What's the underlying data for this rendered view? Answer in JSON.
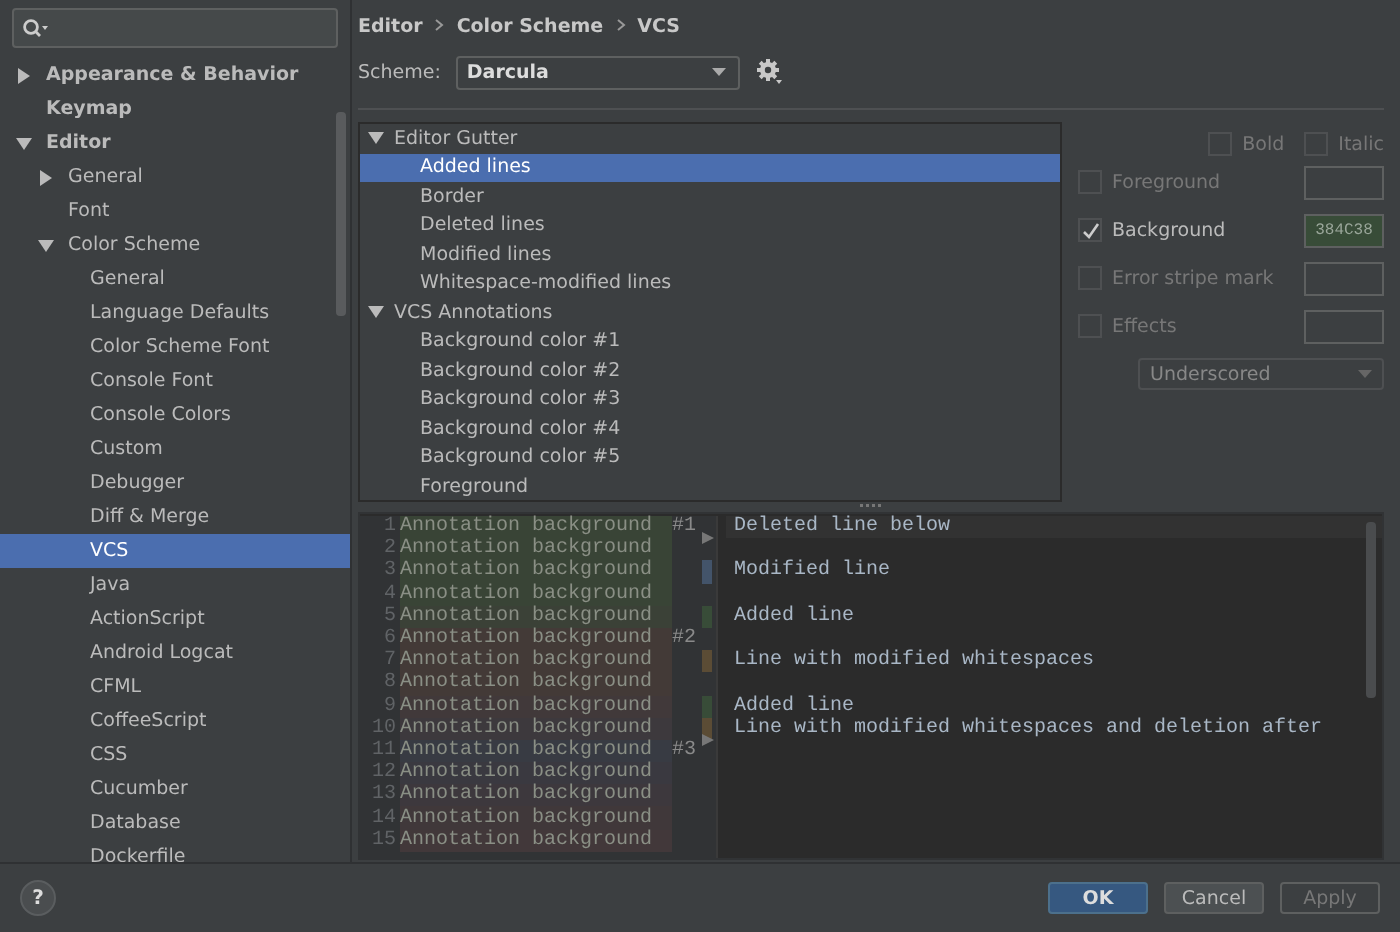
{
  "sidebar": {
    "items": [
      {
        "label": "Appearance & Behavior",
        "expanded": false,
        "selected": false
      },
      {
        "label": "Keymap",
        "selected": false
      },
      {
        "label": "Editor",
        "expanded": true,
        "selected": false,
        "children": [
          {
            "label": "General",
            "expanded": false,
            "selected": false
          },
          {
            "label": "Font",
            "selected": false
          },
          {
            "label": "Color Scheme",
            "expanded": true,
            "selected": false,
            "children": [
              {
                "label": "General",
                "selected": false
              },
              {
                "label": "Language Defaults",
                "selected": false
              },
              {
                "label": "Color Scheme Font",
                "selected": false
              },
              {
                "label": "Console Font",
                "selected": false
              },
              {
                "label": "Console Colors",
                "selected": false
              },
              {
                "label": "Custom",
                "selected": false
              },
              {
                "label": "Debugger",
                "selected": false
              },
              {
                "label": "Diff & Merge",
                "selected": false
              },
              {
                "label": "VCS",
                "selected": true
              },
              {
                "label": "Java",
                "selected": false
              },
              {
                "label": "ActionScript",
                "selected": false
              },
              {
                "label": "Android Logcat",
                "selected": false
              },
              {
                "label": "CFML",
                "selected": false
              },
              {
                "label": "CoffeeScript",
                "selected": false
              },
              {
                "label": "CSS",
                "selected": false
              },
              {
                "label": "Cucumber",
                "selected": false
              },
              {
                "label": "Database",
                "selected": false
              },
              {
                "label": "Dockerfile",
                "selected": false
              }
            ]
          }
        ]
      }
    ]
  },
  "breadcrumb": [
    "Editor",
    "Color Scheme",
    "VCS"
  ],
  "scheme": {
    "label": "Scheme:",
    "value": "Darcula"
  },
  "elements": [
    {
      "label": "Editor Gutter",
      "expanded": true,
      "selected": false,
      "children": [
        {
          "label": "Added lines",
          "selected": true
        },
        {
          "label": "Border",
          "selected": false
        },
        {
          "label": "Deleted lines",
          "selected": false
        },
        {
          "label": "Modified lines",
          "selected": false
        },
        {
          "label": "Whitespace-modified lines",
          "selected": false
        }
      ]
    },
    {
      "label": "VCS Annotations",
      "expanded": true,
      "selected": false,
      "children": [
        {
          "label": "Background color #1",
          "selected": false
        },
        {
          "label": "Background color #2",
          "selected": false
        },
        {
          "label": "Background color #3",
          "selected": false
        },
        {
          "label": "Background color #4",
          "selected": false
        },
        {
          "label": "Background color #5",
          "selected": false
        },
        {
          "label": "Foreground",
          "selected": false
        }
      ]
    }
  ],
  "font_style": [
    {
      "label": "Bold",
      "checked": false
    },
    {
      "label": "Italic",
      "checked": false
    }
  ],
  "attributes": [
    {
      "label": "Foreground",
      "checked": false
    },
    {
      "label": "Background",
      "checked": true,
      "value": "384C38",
      "color": "#384c38"
    },
    {
      "label": "Error stripe mark",
      "checked": false
    },
    {
      "label": "Effects",
      "checked": false
    }
  ],
  "effect_type": {
    "value": "Underscored",
    "disabled": true
  },
  "preview": {
    "lines": [
      {
        "number": "1",
        "annotation": "Annotation background",
        "tag": "#1",
        "color": "#394436",
        "code": "Deleted line below",
        "kind": "deleted"
      },
      {
        "number": "2",
        "annotation": "Annotation background",
        "color": "#394436",
        "kind": "plain"
      },
      {
        "number": "3",
        "annotation": "Annotation background",
        "color": "#394436",
        "code": "Modified line",
        "kind": "modified"
      },
      {
        "number": "4",
        "annotation": "Annotation background",
        "color": "#394436",
        "kind": "plain"
      },
      {
        "number": "5",
        "annotation": "Annotation background",
        "color": "#3b4137",
        "code": "Added line",
        "kind": "added"
      },
      {
        "number": "6",
        "annotation": "Annotation background",
        "tag": "#2",
        "color": "#433a37",
        "kind": "plain"
      },
      {
        "number": "7",
        "annotation": "Annotation background",
        "color": "#433a37",
        "code": "Line with modified whitespaces",
        "kind": "whitespace"
      },
      {
        "number": "8",
        "annotation": "Annotation background",
        "color": "#433a37",
        "kind": "plain"
      },
      {
        "number": "9",
        "annotation": "Annotation background",
        "color": "#41393a",
        "code": "Added line",
        "kind": "added"
      },
      {
        "number": "10",
        "annotation": "Annotation background",
        "color": "#3d393d",
        "code": "Line with modified whitespaces and deletion after",
        "kind": "whitespace_deleted"
      },
      {
        "number": "11",
        "annotation": "Annotation background",
        "tag": "#3",
        "color": "#383b43",
        "kind": "plain"
      },
      {
        "number": "12",
        "annotation": "Annotation background",
        "color": "#3a3940",
        "kind": "plain"
      },
      {
        "number": "13",
        "annotation": "Annotation background",
        "color": "#3d383d",
        "kind": "plain"
      },
      {
        "number": "14",
        "annotation": "Annotation background",
        "color": "#40383a",
        "kind": "plain"
      },
      {
        "number": "15",
        "annotation": "Annotation background",
        "color": "#42383a",
        "kind": "plain"
      }
    ]
  },
  "help": "?",
  "buttons": [
    {
      "label": "OK",
      "kind": "primary",
      "disabled": false
    },
    {
      "label": "Cancel",
      "kind": "normal",
      "disabled": false
    },
    {
      "label": "Apply",
      "kind": "normal",
      "disabled": true
    }
  ]
}
